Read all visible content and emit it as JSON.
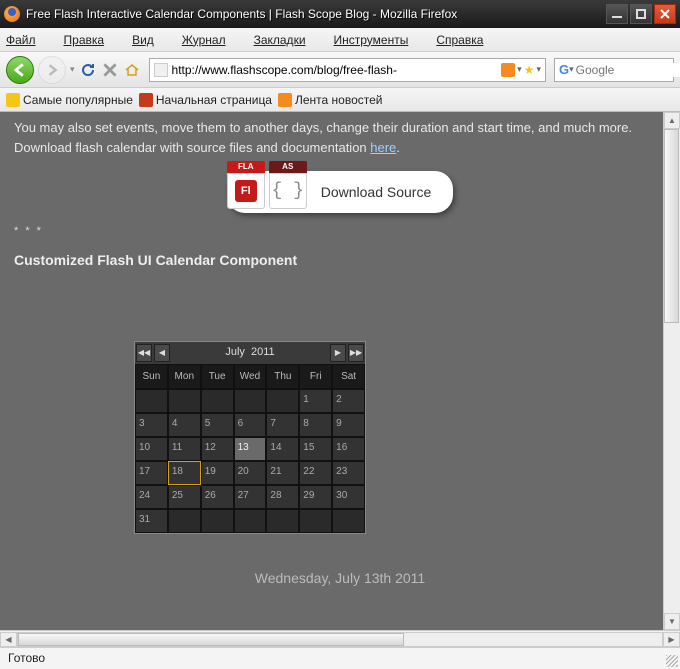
{
  "window": {
    "title": "Free Flash Interactive Calendar Components | Flash Scope Blog - Mozilla Firefox"
  },
  "menu": {
    "file": "Файл",
    "edit": "Правка",
    "view": "Вид",
    "history": "Журнал",
    "bookmarks": "Закладки",
    "tools": "Инструменты",
    "help": "Справка"
  },
  "toolbar": {
    "url": "http://www.flashscope.com/blog/free-flash-",
    "search_engine": "G",
    "search_placeholder": "Google"
  },
  "bookmarks": {
    "popular": "Самые популярные",
    "home": "Начальная страница",
    "news": "Лента новостей"
  },
  "page": {
    "intro": "You may also set events, move them to another days, change their duration and start time, and much more.",
    "dl_line_pre": "Download flash calendar with source files and documentation ",
    "dl_link": "here",
    "dl_line_post": ".",
    "download_btn": "Download Source",
    "fla_tag": "FLA",
    "fla_label": "Fl",
    "as_tag": "AS",
    "as_label": "{ }",
    "heading": "Customized Flash UI Calendar Component",
    "date_label": "Wednesday, July 13th 2011"
  },
  "calendar": {
    "month": "July",
    "year": "2011",
    "prev_year": "◀◀",
    "prev_month": "◀",
    "next_month": "▶",
    "next_year": "▶▶",
    "daynames": [
      "Sun",
      "Mon",
      "Tue",
      "Wed",
      "Thu",
      "Fri",
      "Sat"
    ],
    "weeks": [
      [
        "",
        "",
        "",
        "",
        "",
        "1",
        "2"
      ],
      [
        "3",
        "4",
        "5",
        "6",
        "7",
        "8",
        "9"
      ],
      [
        "10",
        "11",
        "12",
        "13",
        "14",
        "15",
        "16"
      ],
      [
        "17",
        "18",
        "19",
        "20",
        "21",
        "22",
        "23"
      ],
      [
        "24",
        "25",
        "26",
        "27",
        "28",
        "29",
        "30"
      ],
      [
        "31",
        "",
        "",
        "",
        "",
        "",
        ""
      ]
    ],
    "selected": "13",
    "today": "18"
  },
  "status": {
    "text": "Готово"
  }
}
